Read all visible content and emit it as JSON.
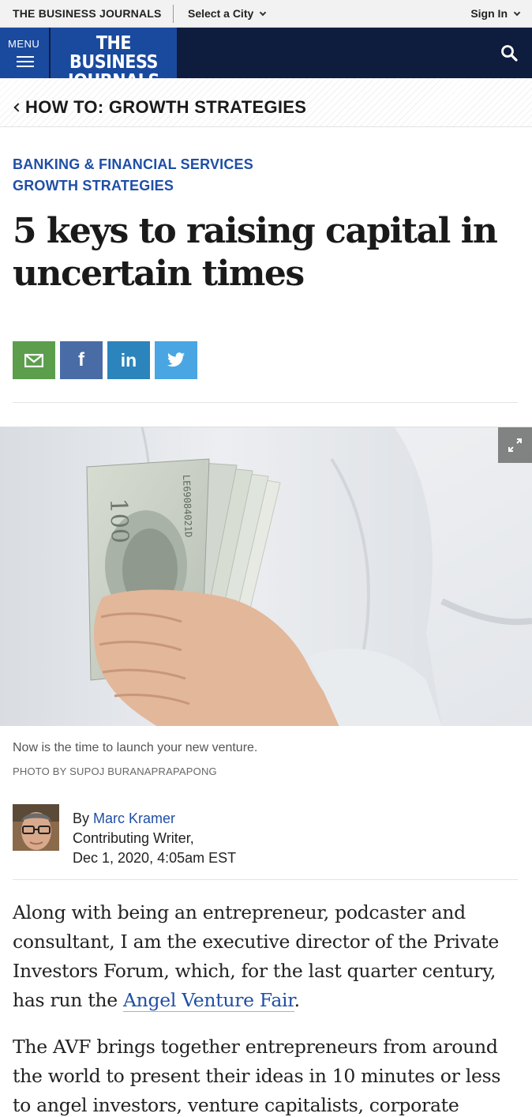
{
  "topbar": {
    "brand": "THE BUSINESS JOURNALS",
    "city_select": "Select a City",
    "sign_in": "Sign In"
  },
  "navbar": {
    "menu_label": "MENU",
    "logo_line1": "THE BUSINESS",
    "logo_line2": "JOURNALS",
    "search_icon": "search-icon"
  },
  "section": {
    "title": "HOW TO: GROWTH STRATEGIES"
  },
  "article": {
    "categories": [
      "BANKING & FINANCIAL SERVICES",
      "GROWTH STRATEGIES"
    ],
    "headline": "5 keys to raising capital in uncertain times",
    "share": {
      "icons": [
        "email-icon",
        "facebook-icon",
        "linkedin-icon",
        "twitter-icon"
      ],
      "colors": [
        "#5c9e4c",
        "#4a6ca6",
        "#2c84bc",
        "#49a6e3"
      ]
    },
    "photo": {
      "caption": "Now is the time to launch your new venture.",
      "credit": "PHOTO BY SUPOJ BURANAPRAPAPONG"
    },
    "byline": {
      "by": "By ",
      "author": "Marc Kramer",
      "role": "Contributing Writer,",
      "date": "Dec 1, 2020, 4:05am EST"
    },
    "body": {
      "p1_before": "Along with being an entrepreneur, podcaster and consultant, I am the executive director of the Private Investors Forum, which, for the last quarter century, has run the ",
      "p1_link": "Angel Venture Fair",
      "p1_after": ".",
      "p2": "The AVF brings together entrepreneurs from around the world to present their ideas in 10 minutes or less to angel investors, venture capitalists, corporate business"
    }
  }
}
